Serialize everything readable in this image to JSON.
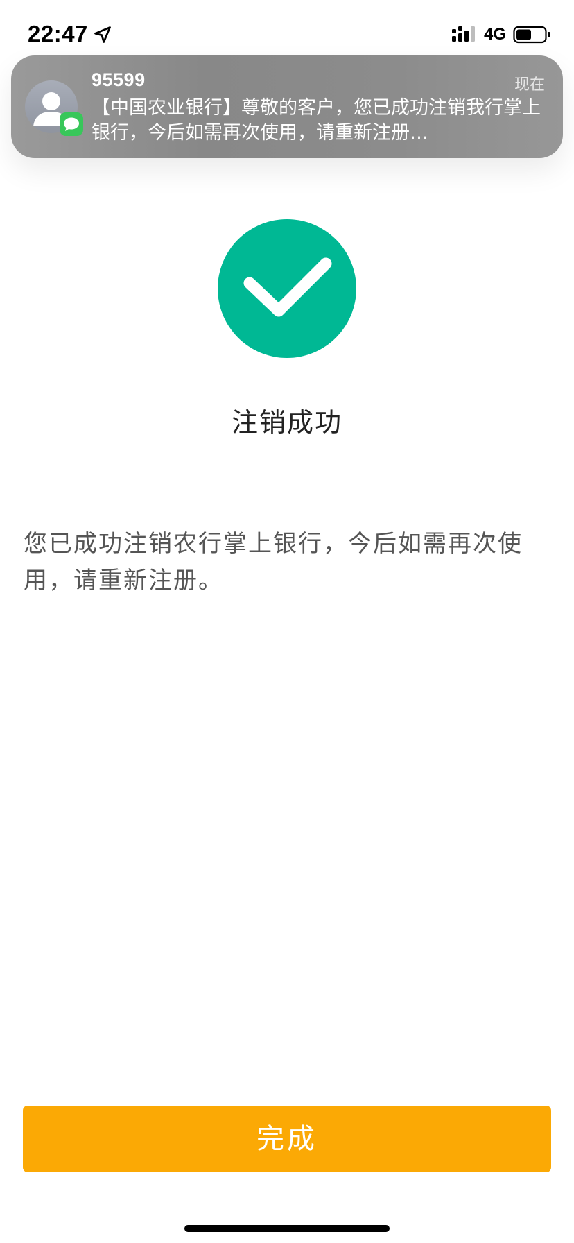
{
  "status_bar": {
    "time": "22:47",
    "network": "4G",
    "icons": [
      "location-arrow-icon",
      "cellular-signal-icon",
      "battery-icon"
    ]
  },
  "notification": {
    "sender": "95599",
    "time": "现在",
    "body": "【中国农业银行】尊敬的客户，您已成功注销我行掌上银行，今后如需再次使用，请重新注册…",
    "icons": [
      "contact-avatar-icon",
      "messages-app-icon"
    ]
  },
  "main": {
    "status_icon": "checkmark-circle-icon",
    "title": "注销成功",
    "description": "您已成功注销农行掌上银行，今后如需再次使用，请重新注册。"
  },
  "footer": {
    "done_label": "完成"
  },
  "colors": {
    "accent": "#fba905",
    "success": "#00b894",
    "notification_bg": "#8c8c8c",
    "message_badge": "#38c75a"
  }
}
